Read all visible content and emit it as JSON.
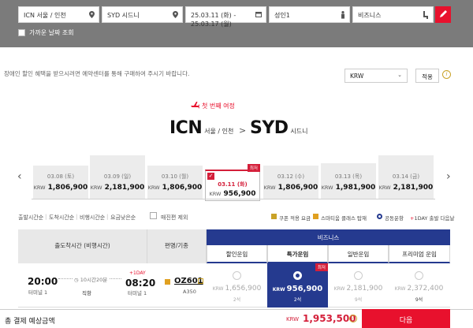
{
  "search": {
    "origin": "ICN 서울 / 인천",
    "destination": "SYD 시드니",
    "dates": "25.03.11 (화) - 25.03.17 (월)",
    "passengers": "성인1",
    "cabin": "비즈니스",
    "flexible_dates_label": "가까운 날짜 조회"
  },
  "notice": "장애인 할인 혜택을 받으시려면 예약센터를 통해 구매하여 주시기 바랍니다.",
  "currency": {
    "selected": "KRW",
    "apply_label": "적용",
    "info": "i"
  },
  "journey": {
    "heading": "첫 번째 여정",
    "from_code": "ICN",
    "from_city": "서울 / 인천",
    "to_code": "SYD",
    "to_city": "시드니"
  },
  "dates": [
    {
      "date": "03.08 (토)",
      "currency": "KRW",
      "price": "1,806,900",
      "selected": false
    },
    {
      "date": "03.09 (일)",
      "currency": "KRW",
      "price": "2,181,900",
      "selected": false
    },
    {
      "date": "03.10 (월)",
      "currency": "KRW",
      "price": "1,806,900",
      "selected": false
    },
    {
      "date": "03.11 (화)",
      "currency": "KRW",
      "price": "956,900",
      "selected": true,
      "badge": "최저"
    },
    {
      "date": "03.12 (수)",
      "currency": "KRW",
      "price": "1,806,900",
      "selected": false
    },
    {
      "date": "03.13 (목)",
      "currency": "KRW",
      "price": "1,981,900",
      "selected": false
    },
    {
      "date": "03.14 (금)",
      "currency": "KRW",
      "price": "2,181,900",
      "selected": false
    }
  ],
  "sort": [
    "출발시간순",
    "도착시간순",
    "비행시간순",
    "요금낮은순"
  ],
  "full_seat_exclude": "매진편 제외",
  "legend": [
    "쿠폰 적용 요금",
    "스마티움 클래스 탑재",
    "공동운항",
    "1DAY 출발 다음날"
  ],
  "table": {
    "col_depart": "출도착시간 (비행시간)",
    "col_flight": "편명/기종",
    "cabin_header": "비즈니스",
    "fare_types": [
      "할인운임",
      "특가운임",
      "일반운임",
      "프리미엄 운임"
    ]
  },
  "flight": {
    "dep_time": "20:00",
    "dep_terminal": "터미널 1",
    "duration": "10시간20분",
    "stops": "직항",
    "next_day": "+1DAY",
    "arr_time": "08:20",
    "arr_terminal": "터미널 1",
    "flight_no": "OZ601",
    "aircraft": "A350",
    "fares": [
      {
        "currency": "KRW",
        "price": "1,656,900",
        "seats": "2석",
        "selected": false
      },
      {
        "currency": "KRW",
        "price": "956,900",
        "seats": "2석",
        "selected": true,
        "badge": "최저"
      },
      {
        "currency": "KRW",
        "price": "2,181,900",
        "seats": "9석",
        "selected": false
      },
      {
        "currency": "KRW",
        "price": "2,372,400",
        "seats": "9석",
        "selected": false
      }
    ]
  },
  "total": {
    "label": "총 결제 예상금액",
    "currency": "KRW",
    "amount": "1,953,500",
    "next_label": "다음"
  }
}
